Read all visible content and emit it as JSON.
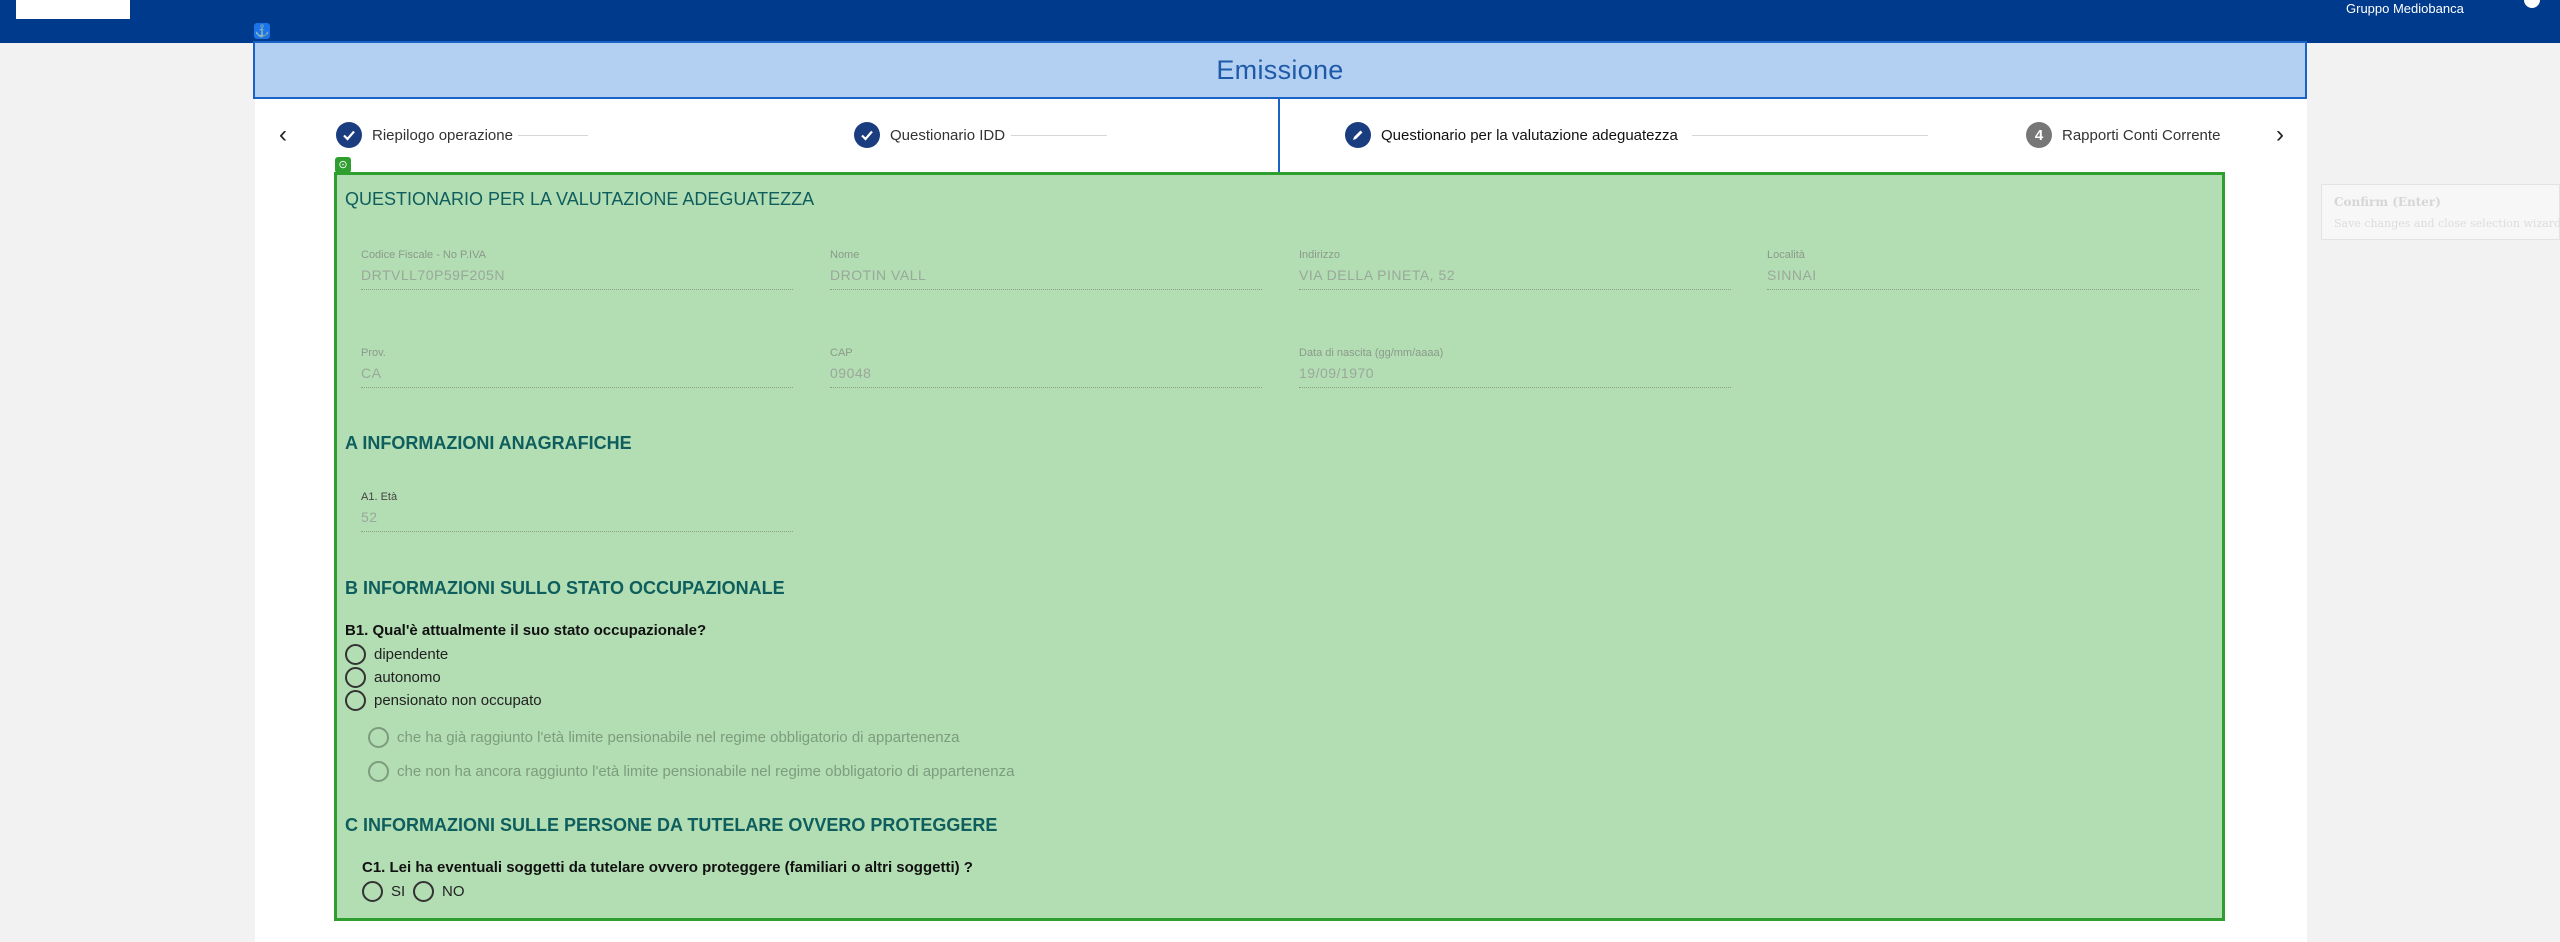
{
  "topbar": {
    "brand_text": "Gruppo Mediobanca"
  },
  "header": {
    "title": "Emissione",
    "anchor_icon": "anchor-icon"
  },
  "stepper": {
    "prev_icon": "chevron-left-icon",
    "next_icon": "chevron-right-icon",
    "steps": [
      {
        "label": "Riepilogo operazione",
        "state": "done",
        "icon": "check-icon"
      },
      {
        "label": "Questionario IDD",
        "state": "done",
        "icon": "check-icon"
      },
      {
        "label": "Questionario per la valutazione adeguatezza",
        "state": "active",
        "icon": "pencil-icon"
      },
      {
        "label": "Rapporti Conti Corrente",
        "state": "pending",
        "number": "4"
      }
    ]
  },
  "form": {
    "title": "QUESTIONARIO PER LA VALUTAZIONE ADEGUATEZZA",
    "fields": {
      "codice_fiscale": {
        "label": "Codice Fiscale - No P.IVA",
        "value": "DRTVLL70P59F205N"
      },
      "nome": {
        "label": "Nome",
        "value": "DROTIN VALL"
      },
      "indirizzo": {
        "label": "Indirizzo",
        "value": "VIA DELLA PINETA, 52"
      },
      "localita": {
        "label": "Località",
        "value": "SINNAI"
      },
      "prov": {
        "label": "Prov.",
        "value": "CA"
      },
      "cap": {
        "label": "CAP",
        "value": "09048"
      },
      "data_nascita": {
        "label": "Data di nascita (gg/mm/aaaa)",
        "value": "19/09/1970"
      }
    },
    "section_a": {
      "title": "A INFORMAZIONI ANAGRAFICHE",
      "eta_label": "A1. Età",
      "eta_value": "52"
    },
    "section_b": {
      "title": "B INFORMAZIONI SULLO STATO OCCUPAZIONALE",
      "question": "B1. Qual'è attualmente il suo stato occupazionale?",
      "options": [
        "dipendente",
        "autonomo",
        "pensionato non occupato"
      ],
      "sub_options": [
        "che ha già raggiunto l'età limite pensionabile nel regime obbligatorio di appartenenza",
        "che non ha ancora raggiunto l'età limite pensionabile nel regime obbligatorio di appartenenza"
      ]
    },
    "section_c": {
      "title": "C INFORMAZIONI SULLE PERSONE DA TUTELARE OVVERO PROTEGGERE",
      "question": "C1. Lei ha eventuali soggetti da tutelare ovvero proteggere (familiari o altri soggetti) ?",
      "options": [
        "SI",
        "NO"
      ]
    }
  },
  "ghost_panel": {
    "title": "Confirm (Enter)",
    "subtitle": "Save changes and close selection wizard"
  },
  "colors": {
    "topbar": "#003a8c",
    "header_bg": "#b3d0f2",
    "form_bg": "#b3ddb3",
    "selection_border": "#2e9e2e",
    "step_done": "#1a3d80"
  }
}
